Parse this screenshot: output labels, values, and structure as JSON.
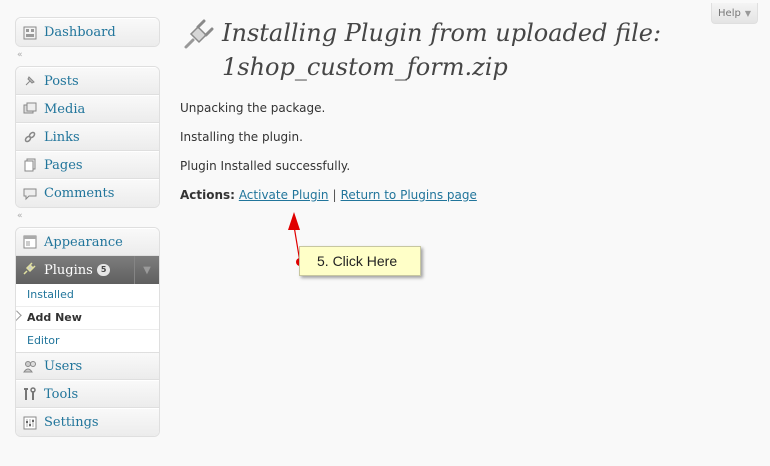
{
  "help": {
    "label": "Help"
  },
  "sidebar": {
    "dashboard": "Dashboard",
    "content_items": [
      "Posts",
      "Media",
      "Links",
      "Pages",
      "Comments"
    ],
    "appearance": "Appearance",
    "plugins": {
      "label": "Plugins",
      "count": "5"
    },
    "plugins_submenu": [
      "Installed",
      "Add New",
      "Editor"
    ],
    "bottom_items": [
      "Users",
      "Tools",
      "Settings"
    ]
  },
  "main": {
    "title_line1": "Installing Plugin from uploaded file:",
    "title_line2": "1shop_custom_form.zip",
    "messages": [
      "Unpacking the package.",
      "Installing the plugin.",
      "Plugin Installed successfully."
    ],
    "actions_label": "Actions:",
    "activate_link": "Activate Plugin",
    "separator": "|",
    "return_link": "Return to Plugins page"
  },
  "callout": {
    "text": "5. Click Here"
  },
  "colors": {
    "link": "#21759b",
    "callout_bg": "#ffffc8",
    "arrow": "#e00000"
  }
}
